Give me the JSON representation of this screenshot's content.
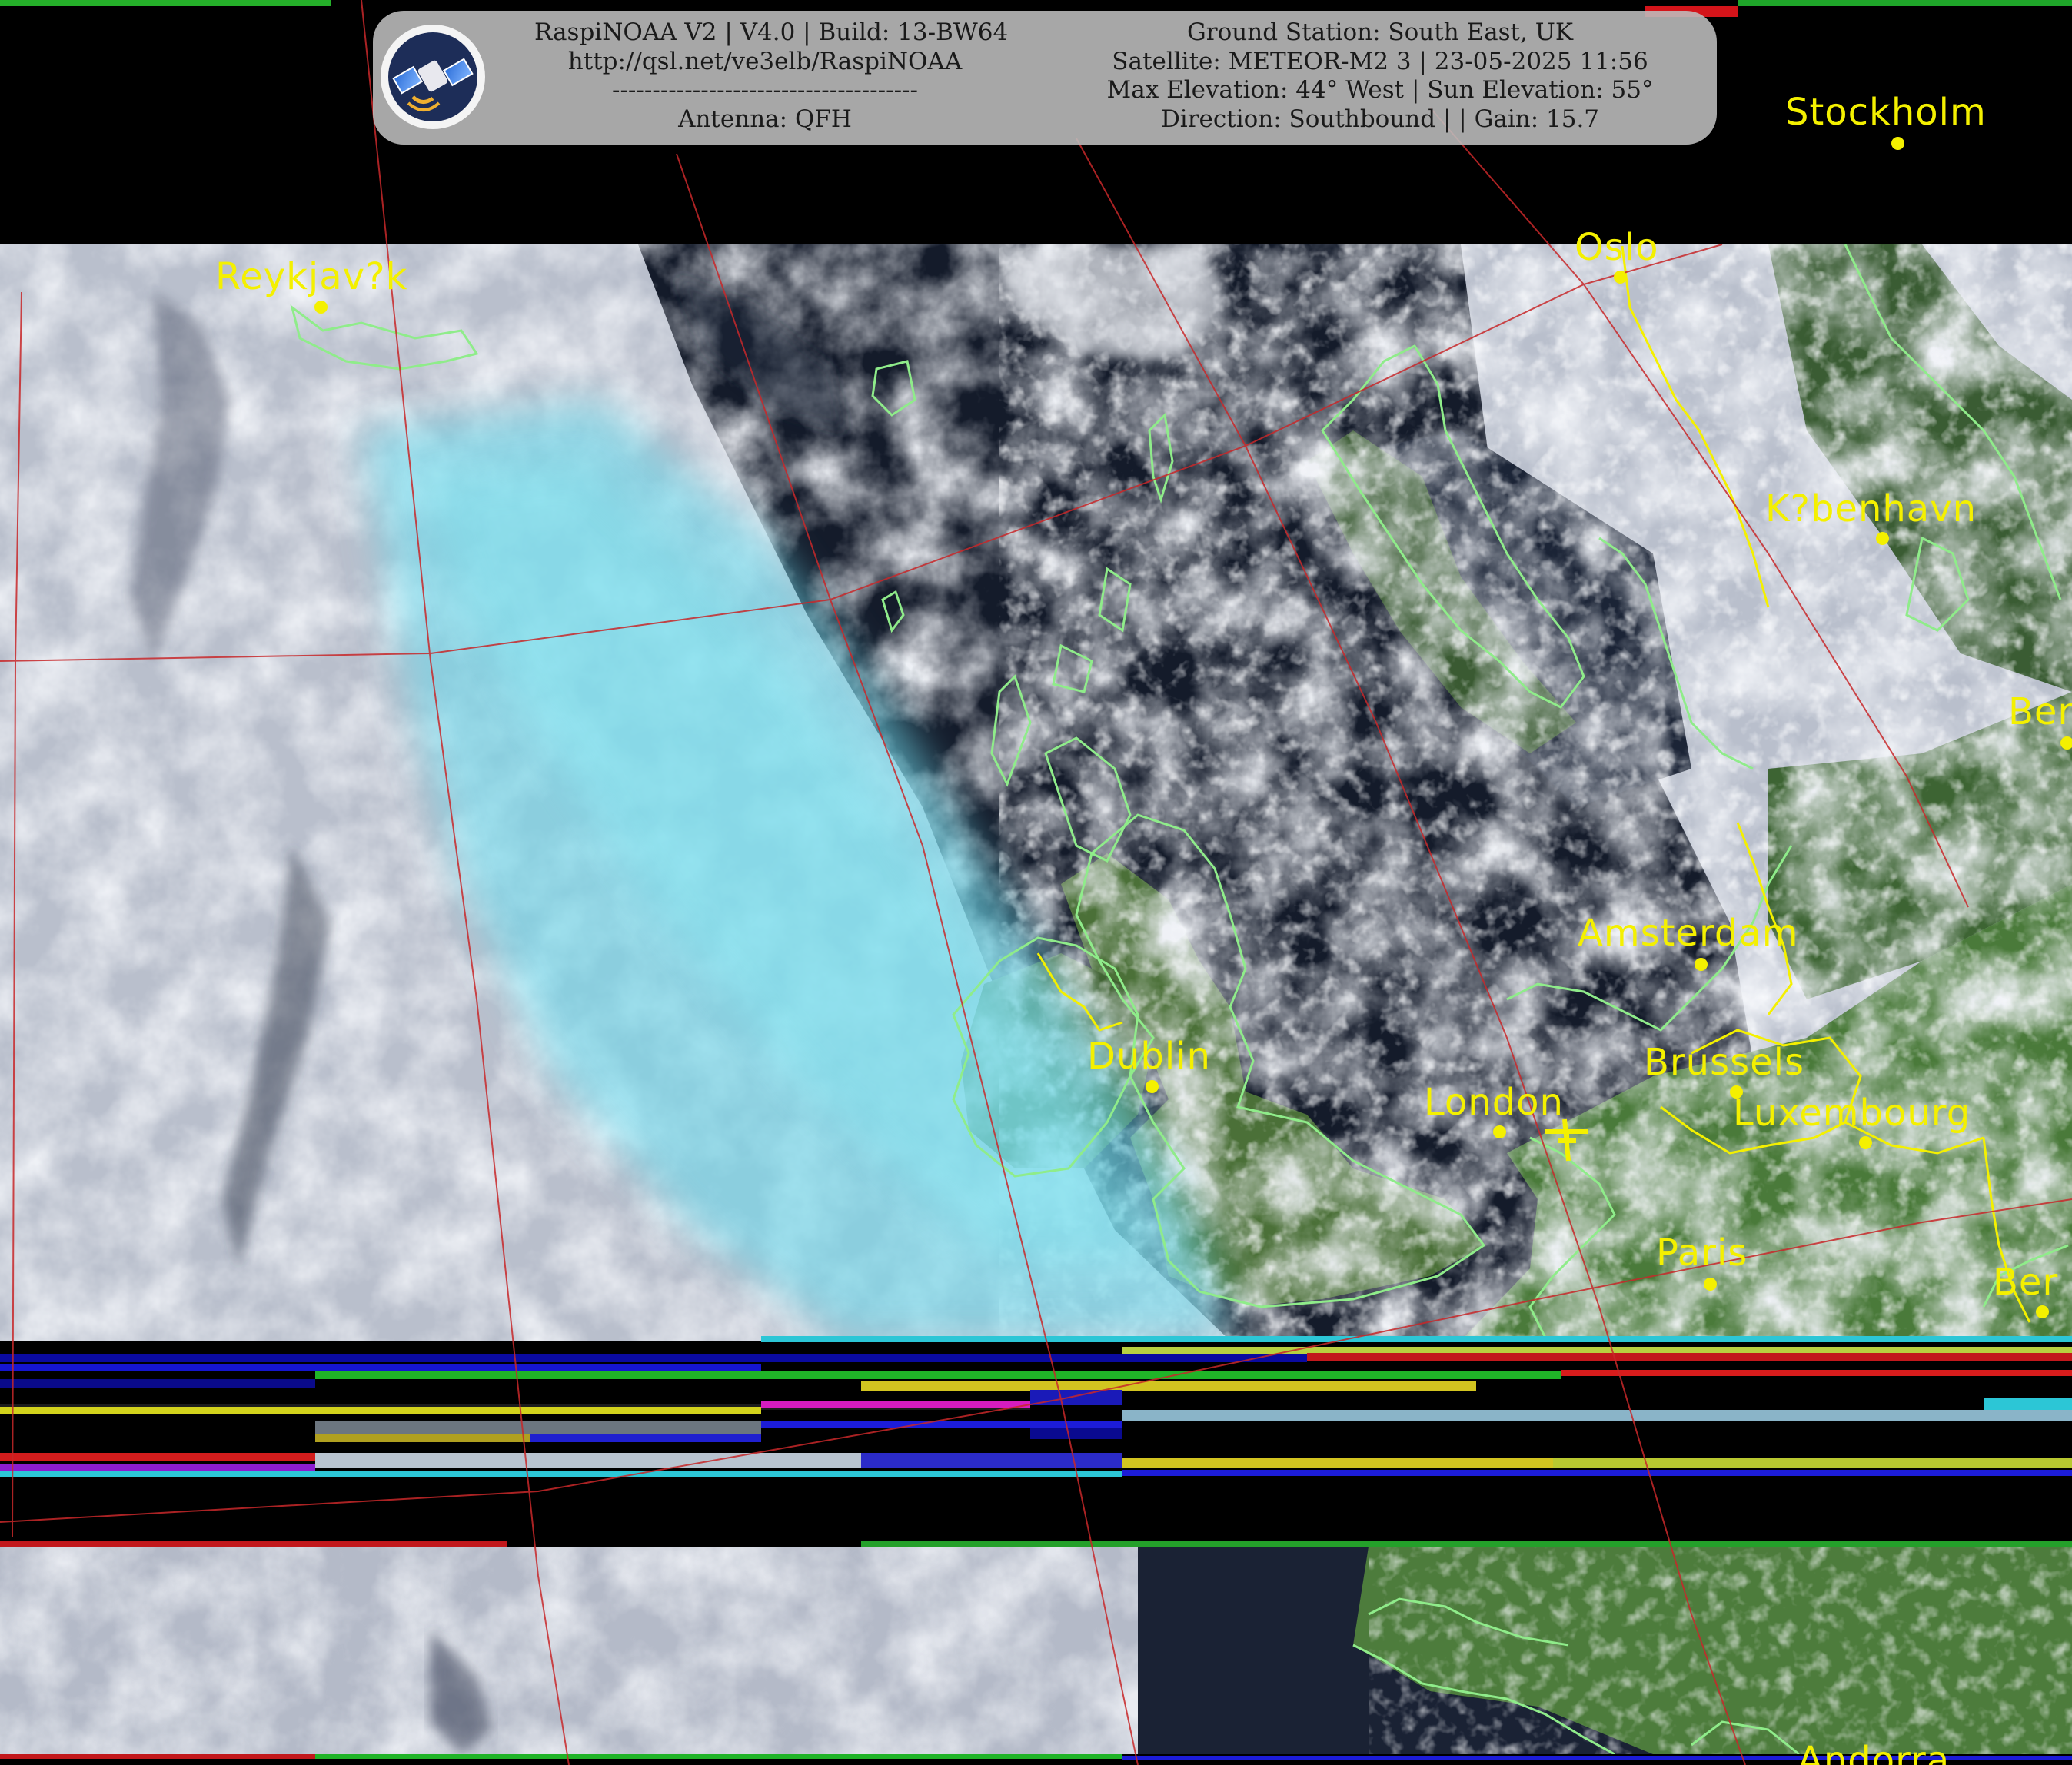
{
  "banner": {
    "left_lines": [
      "RaspiNOAA V2 | V4.0 | Build: 13-BW64",
      "http://qsl.net/ve3elb/RaspiNOAA",
      "--------------------------------------",
      "Antenna: QFH"
    ],
    "right_lines": [
      "Ground Station: South East, UK",
      "Satellite: METEOR-M2 3 | 23-05-2025 11:56",
      "Max Elevation: 44° West | Sun Elevation: 55°",
      "Direction: Southbound | | Gain: 15.7"
    ]
  },
  "cities": [
    {
      "id": "stockholm",
      "label": "Stockholm"
    },
    {
      "id": "oslo",
      "label": "Oslo"
    },
    {
      "id": "reykjavik",
      "label": "Reykjav?k"
    },
    {
      "id": "kobenhavn",
      "label": "K?benhavn"
    },
    {
      "id": "berlin",
      "label": "Ber"
    },
    {
      "id": "amsterdam",
      "label": "Amsterdam"
    },
    {
      "id": "dublin",
      "label": "Dublin"
    },
    {
      "id": "brussels",
      "label": "Brussels"
    },
    {
      "id": "london",
      "label": "London"
    },
    {
      "id": "luxembourg",
      "label": "Luxembourg"
    },
    {
      "id": "paris",
      "label": "Paris"
    },
    {
      "id": "bern",
      "label": "Ber"
    },
    {
      "id": "andorra",
      "label": "Andorra"
    }
  ],
  "colors": {
    "label": "#f4f000",
    "coastline": "#8fec8a",
    "grid": "#c8282a",
    "cloud": "#d9dde4",
    "ice_cloud": "#74dcec",
    "sea": "#151c2c",
    "land": "#4f7a3c"
  }
}
